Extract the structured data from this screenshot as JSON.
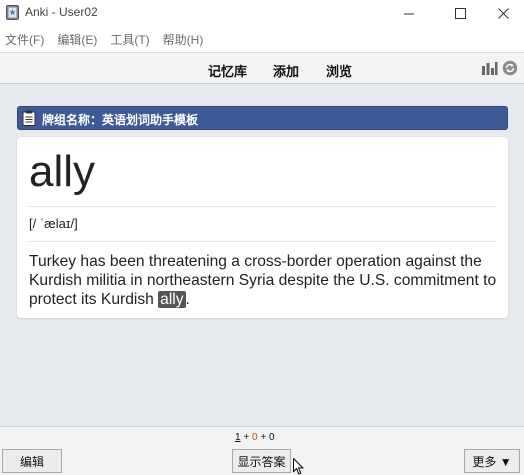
{
  "window": {
    "title": "Anki - User02",
    "controls": {
      "minimize": "—",
      "maximize": "☐",
      "close": "✕"
    }
  },
  "menu": [
    {
      "label": "文件(F)"
    },
    {
      "label": "编辑(E)"
    },
    {
      "label": "工具(T)"
    },
    {
      "label": "帮助(H)"
    }
  ],
  "toolbar": {
    "decks": "记忆库",
    "add": "添加",
    "browse": "浏览",
    "icons": [
      "stats-icon",
      "sync-icon"
    ]
  },
  "deck": {
    "label": "牌组名称：英语划词助手模板"
  },
  "card": {
    "word": "ally",
    "phonetic": "[/ ˈælaɪ/]",
    "sentence_before": "Turkey has been threatening a cross-border operation against the Kurdish militia in northeastern Syria despite the U.S. commitment to protect its Kurdish ",
    "sentence_highlight": "ally",
    "sentence_after": "."
  },
  "footer": {
    "counts": {
      "new": "1",
      "plus1": "+",
      "learn": "0",
      "plus2": "+",
      "review": "0"
    },
    "edit_button": "编辑",
    "show_answer_button": "显示答案",
    "more_button": "更多 ▼"
  },
  "colors": {
    "deck_bar": "#3d5a96",
    "learn_count": "#c35617",
    "highlight_bg": "#555555"
  }
}
